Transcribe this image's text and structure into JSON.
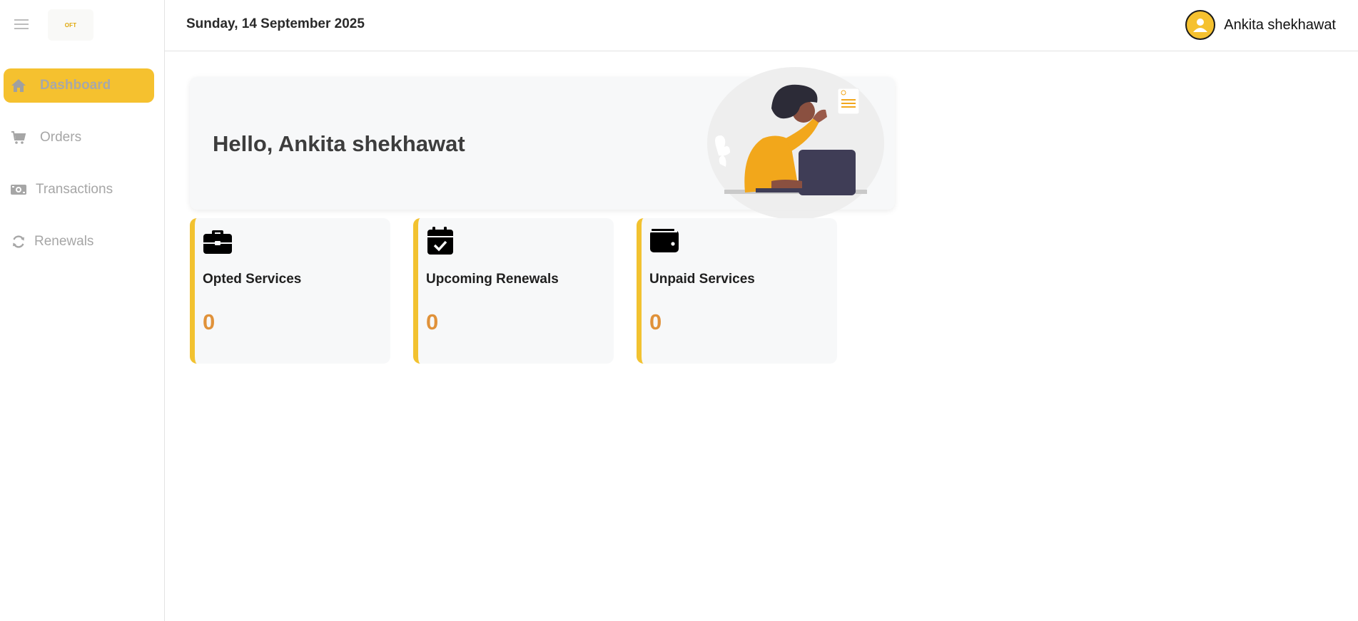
{
  "sidebar": {
    "menu_icon": "hamburger-icon",
    "logo_text": "OFT",
    "items": [
      {
        "label": "Dashboard",
        "icon": "home-icon",
        "active": true
      },
      {
        "label": "Orders",
        "icon": "cart-icon",
        "active": false
      },
      {
        "label": "Transactions",
        "icon": "money-icon",
        "active": false
      },
      {
        "label": "Renewals",
        "icon": "refresh-icon",
        "active": false
      }
    ]
  },
  "header": {
    "date": "Sunday, 14 September 2025",
    "user_name": "Ankita shekhawat",
    "avatar_icon": "user-avatar-icon"
  },
  "banner": {
    "greeting": "Hello, Ankita shekhawat"
  },
  "cards": [
    {
      "title": "Opted Services",
      "value": "0",
      "icon": "briefcase-icon"
    },
    {
      "title": "Upcoming Renewals",
      "value": "0",
      "icon": "calendar-check-icon"
    },
    {
      "title": "Unpaid Services",
      "value": "0",
      "icon": "wallet-icon"
    }
  ],
  "colors": {
    "accent": "#f5c12f",
    "card_value": "#e0923a",
    "card_bg": "#f7f8f9"
  }
}
